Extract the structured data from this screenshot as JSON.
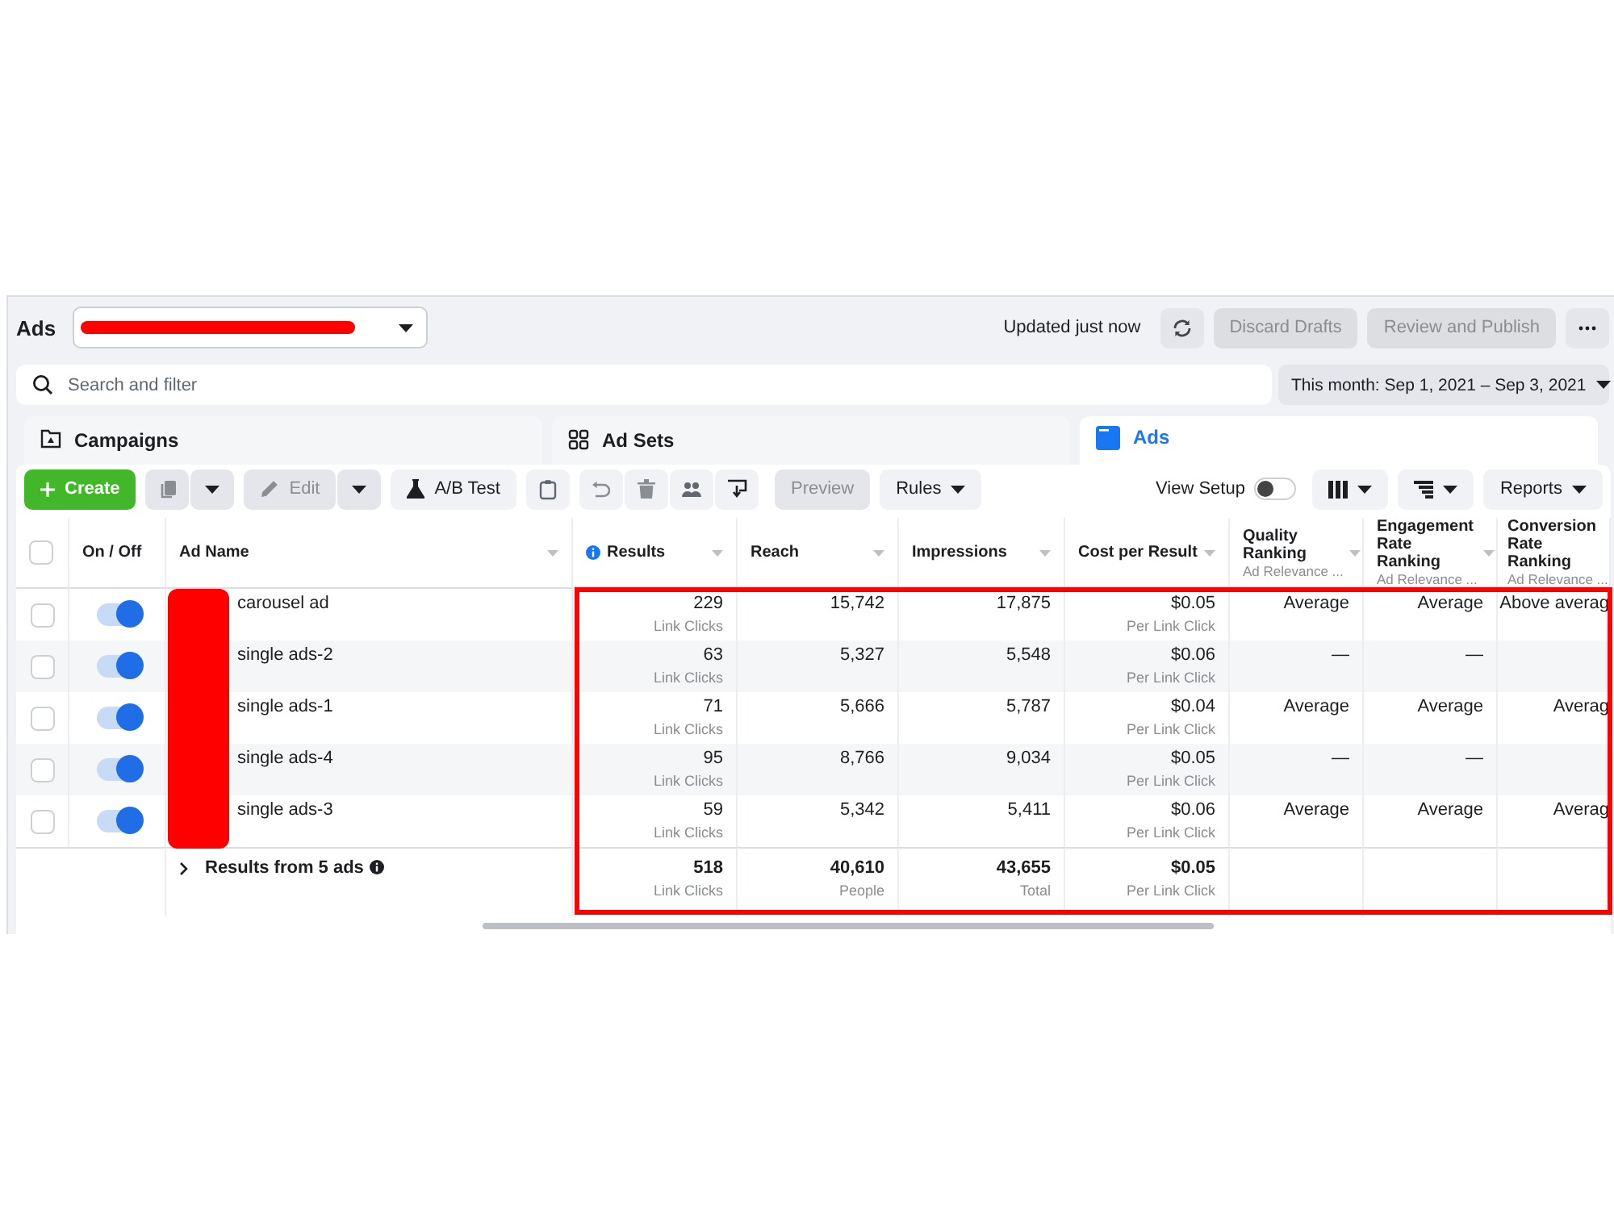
{
  "header": {
    "title": "Ads",
    "updated": "Updated just now",
    "buttons": [
      {
        "label": "Discard Drafts",
        "disabled": true
      },
      {
        "label": "Review and Publish",
        "disabled": true
      }
    ]
  },
  "search": {
    "placeholder": "Search and filter"
  },
  "date_range": "This month: Sep 1, 2021 – Sep 3, 2021",
  "tabs": [
    {
      "label": "Campaigns",
      "kind": "campaigns",
      "selected": false
    },
    {
      "label": "Ad Sets",
      "kind": "adsets",
      "selected": false
    },
    {
      "label": "Ads",
      "kind": "ads",
      "selected": true
    }
  ],
  "toolbar": {
    "create": "Create",
    "edit": {
      "label": "Edit",
      "disabled": true
    },
    "ab_test": "A/B Test",
    "preview": {
      "label": "Preview",
      "disabled": true
    },
    "rules": "Rules",
    "view_setup": {
      "label": "View Setup",
      "on": false
    },
    "reports": "Reports"
  },
  "table": {
    "select_all": {
      "checked": false
    },
    "columns": [
      {
        "label": "On / Off"
      },
      {
        "label": "Ad Name",
        "sortable": true
      },
      {
        "label": "Results",
        "sortable": true,
        "info": true
      },
      {
        "label": "Reach",
        "sortable": true
      },
      {
        "label": "Impressions",
        "sortable": true
      },
      {
        "label": "Cost per Result",
        "sortable": true
      },
      {
        "label": "Quality Ranking",
        "sub": "Ad Relevance ...",
        "sortable": true
      },
      {
        "label": "Engagement Rate Ranking",
        "sub": "Ad Relevance ...",
        "sortable": true
      },
      {
        "label": "Conversion Rate Ranking",
        "sub": "Ad Relevance ..."
      }
    ],
    "rows": [
      {
        "checked": false,
        "on": true,
        "name": "carousel ad",
        "results": "229",
        "results_unit": "Link Clicks",
        "reach": "15,742",
        "impressions": "17,875",
        "cost": "$0.05",
        "cost_unit": "Per Link Click",
        "quality": "Average",
        "engagement": "Average",
        "conversion": "Above averag"
      },
      {
        "checked": false,
        "on": true,
        "name": "single ads-2",
        "results": "63",
        "results_unit": "Link Clicks",
        "reach": "5,327",
        "impressions": "5,548",
        "cost": "$0.06",
        "cost_unit": "Per Link Click",
        "quality": "—",
        "engagement": "—"
      },
      {
        "checked": false,
        "on": true,
        "name": "single ads-1",
        "results": "71",
        "results_unit": "Link Clicks",
        "reach": "5,666",
        "impressions": "5,787",
        "cost": "$0.04",
        "cost_unit": "Per Link Click",
        "quality": "Average",
        "engagement": "Average",
        "conversion": "Averag"
      },
      {
        "checked": false,
        "on": true,
        "name": "single ads-4",
        "results": "95",
        "results_unit": "Link Clicks",
        "reach": "8,766",
        "impressions": "9,034",
        "cost": "$0.05",
        "cost_unit": "Per Link Click",
        "quality": "—",
        "engagement": "—"
      },
      {
        "checked": false,
        "on": true,
        "name": "single ads-3",
        "results": "59",
        "results_unit": "Link Clicks",
        "reach": "5,342",
        "impressions": "5,411",
        "cost": "$0.06",
        "cost_unit": "Per Link Click",
        "quality": "Average",
        "engagement": "Average",
        "conversion": "Averag"
      }
    ],
    "totals": {
      "label": "Results from 5 ads",
      "results": "518",
      "results_unit": "Link Clicks",
      "reach": "40,610",
      "reach_unit": "People",
      "impressions": "43,655",
      "impressions_unit": "Total",
      "cost": "$0.05",
      "cost_unit": "Per Link Click"
    }
  }
}
